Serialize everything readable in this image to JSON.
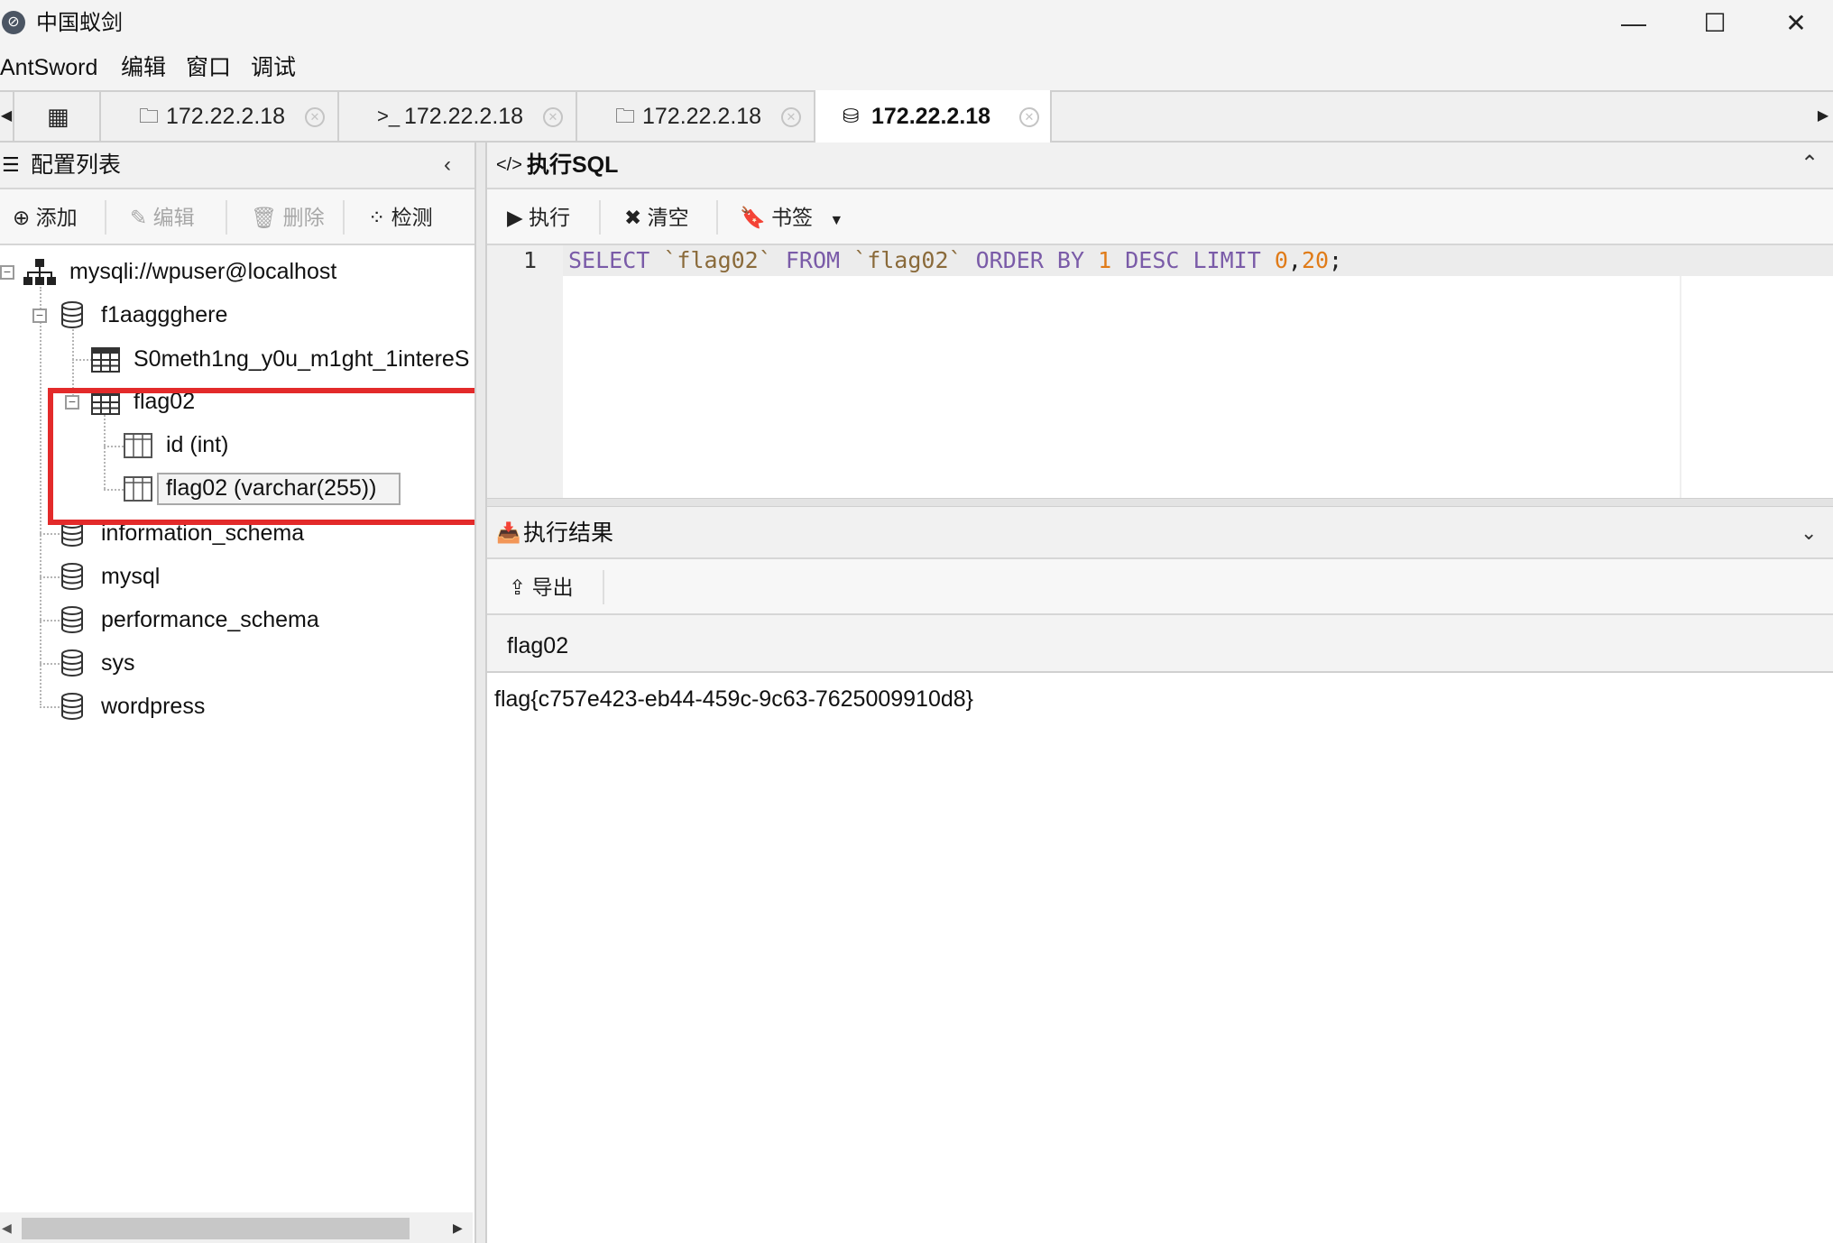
{
  "window": {
    "title": "中国蚁剑",
    "app_icon_glyph": "⊘",
    "minimize": "—",
    "maximize": "☐",
    "close": "✕"
  },
  "menu": [
    "AntSword",
    "编辑",
    "窗口",
    "调试"
  ],
  "tabs": [
    {
      "icon": "▦",
      "label": ""
    },
    {
      "icon": "🗀",
      "label": "172.22.2.18"
    },
    {
      "icon": ">_",
      "label": "172.22.2.18"
    },
    {
      "icon": "🗀",
      "label": "172.22.2.18"
    },
    {
      "icon": "⛁",
      "label": "172.22.2.18",
      "active": true
    }
  ],
  "tab_close_glyph": "✕",
  "left_panel": {
    "title": "配置列表",
    "toolbar": {
      "add": "添加",
      "edit": "编辑",
      "delete": "删除",
      "check": "检测"
    },
    "tree": {
      "connection": "mysqli://wpuser@localhost",
      "databases": [
        {
          "name": "f1aaggghere",
          "tables": [
            {
              "name": "S0meth1ng_y0u_m1ght_1intereS"
            },
            {
              "name": "flag02",
              "columns": [
                "id (int)",
                "flag02 (varchar(255))"
              ]
            }
          ]
        },
        {
          "name": "information_schema"
        },
        {
          "name": "mysql"
        },
        {
          "name": "performance_schema"
        },
        {
          "name": "sys"
        },
        {
          "name": "wordpress"
        }
      ]
    }
  },
  "sql_panel": {
    "title_prefix": "</>",
    "title": "执行SQL",
    "toolbar": {
      "run": "执行",
      "clear": "清空",
      "bookmark": "书签"
    },
    "editor": {
      "line_number": "1",
      "tokens": [
        {
          "text": "SELECT",
          "type": "keyword"
        },
        {
          "text": " ",
          "type": "plain"
        },
        {
          "text": "`flag02`",
          "type": "identifier"
        },
        {
          "text": " ",
          "type": "plain"
        },
        {
          "text": "FROM",
          "type": "keyword"
        },
        {
          "text": " ",
          "type": "plain"
        },
        {
          "text": "`flag02`",
          "type": "identifier"
        },
        {
          "text": " ",
          "type": "plain"
        },
        {
          "text": "ORDER BY",
          "type": "keyword"
        },
        {
          "text": " ",
          "type": "plain"
        },
        {
          "text": "1",
          "type": "number"
        },
        {
          "text": " ",
          "type": "plain"
        },
        {
          "text": "DESC LIMIT",
          "type": "keyword"
        },
        {
          "text": " ",
          "type": "plain"
        },
        {
          "text": "0",
          "type": "number"
        },
        {
          "text": ",",
          "type": "plain"
        },
        {
          "text": "20",
          "type": "number"
        },
        {
          "text": ";",
          "type": "plain"
        }
      ]
    }
  },
  "result_panel": {
    "title": "执行结果",
    "toolbar": {
      "export": "导出"
    },
    "columns": [
      "flag02"
    ],
    "rows": [
      [
        "flag{c757e423-eb44-459c-9c63-7625009910d8}"
      ]
    ]
  },
  "colors": {
    "keyword": "#7a5ba8",
    "identifier": "#8a6a3a",
    "number": "#e07b18",
    "plain": "#222222",
    "highlight": "#e32a2a"
  }
}
